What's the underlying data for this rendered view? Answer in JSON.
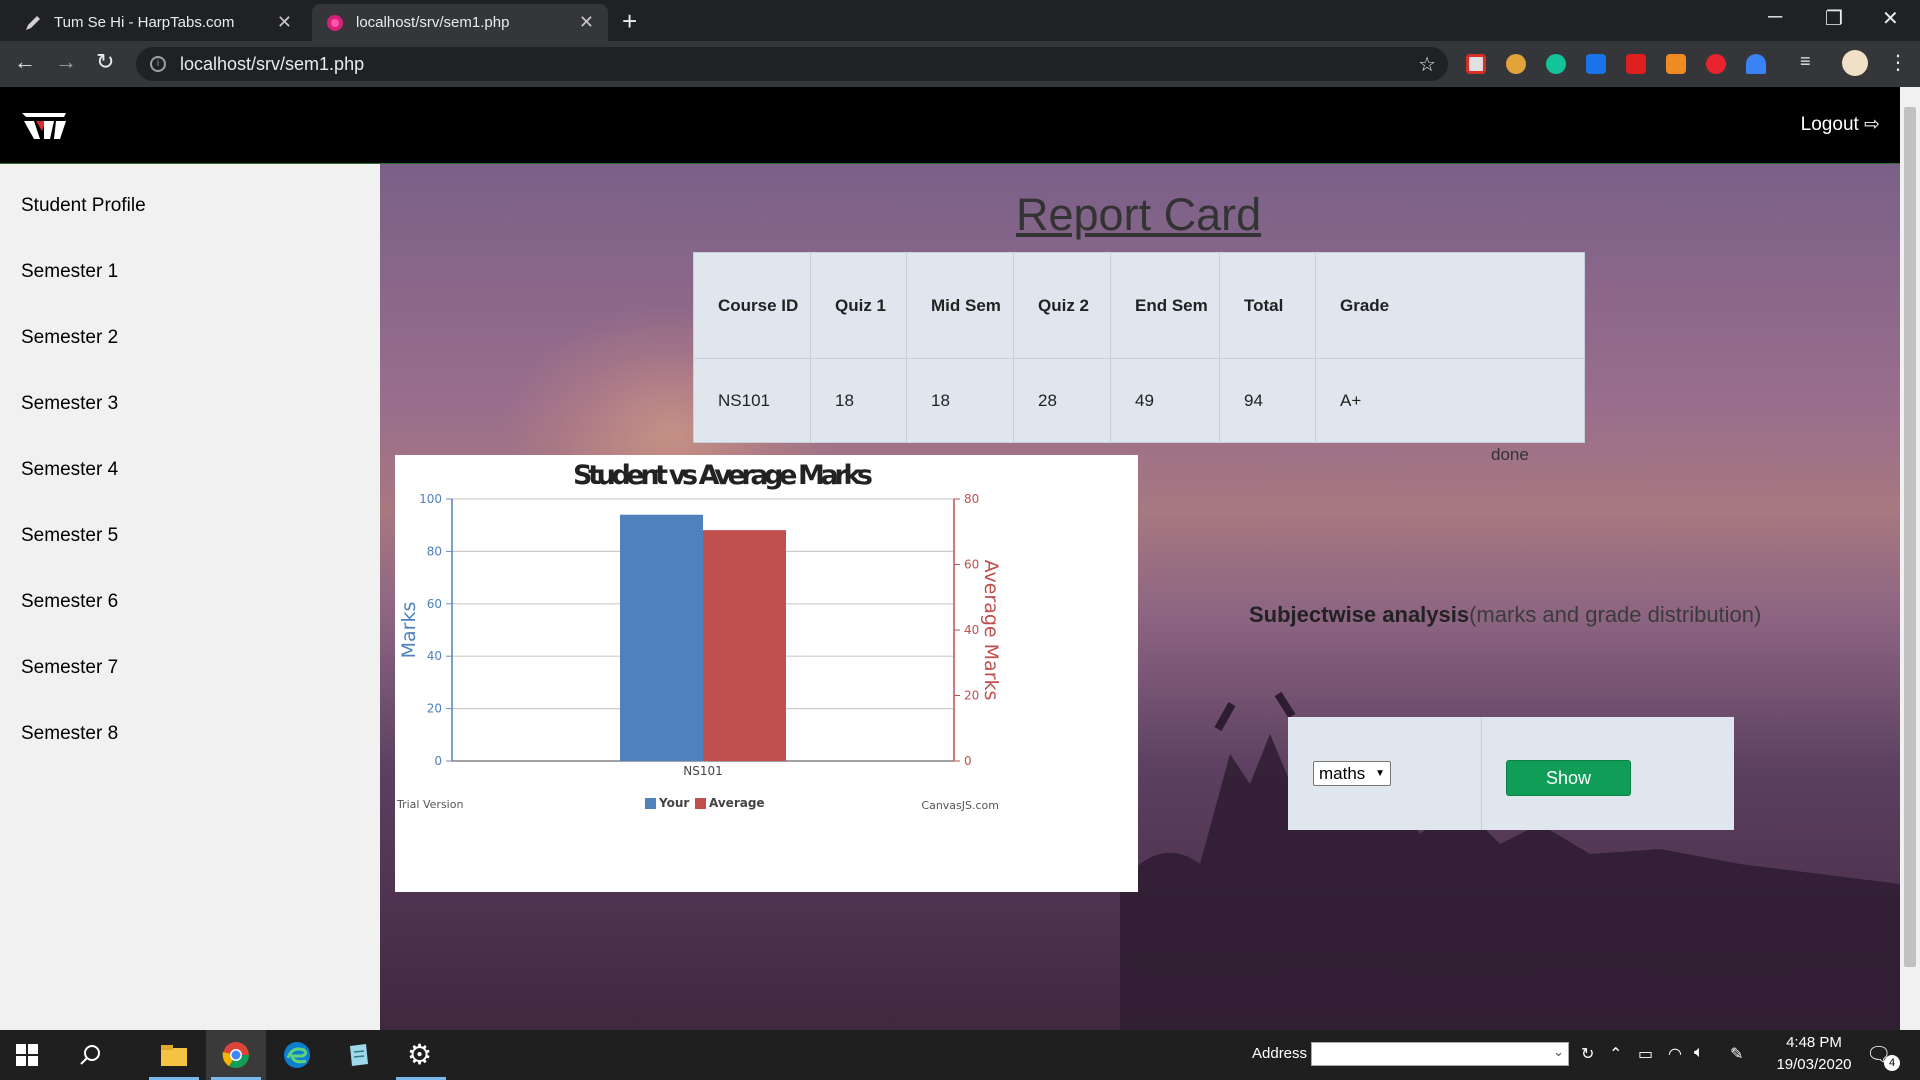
{
  "browser": {
    "tabs": [
      {
        "title": "Tum Se Hi - HarpTabs.com",
        "active": false
      },
      {
        "title": "localhost/srv/sem1.php",
        "active": true
      }
    ],
    "url": "localhost/srv/sem1.php"
  },
  "header": {
    "logout_label": "Logout"
  },
  "sidebar": {
    "items": [
      {
        "label": "Student Profile"
      },
      {
        "label": "Semester 1"
      },
      {
        "label": "Semester 2"
      },
      {
        "label": "Semester 3"
      },
      {
        "label": "Semester 4"
      },
      {
        "label": "Semester 5"
      },
      {
        "label": "Semester 6"
      },
      {
        "label": "Semester 7"
      },
      {
        "label": "Semester 8"
      }
    ]
  },
  "main": {
    "title": "Report Card",
    "table": {
      "headers": [
        "Course ID",
        "Quiz 1",
        "Mid Sem",
        "Quiz 2",
        "End Sem",
        "Total",
        "Grade"
      ],
      "rows": [
        [
          "NS101",
          "18",
          "18",
          "28",
          "49",
          "94",
          "A+"
        ]
      ]
    },
    "status_text": "done",
    "analysis": {
      "bold": "Subjectwise analysis",
      "rest": "(marks and grade distribution)",
      "selected_subject": "maths",
      "show_label": "Show"
    }
  },
  "chart_data": {
    "type": "bar",
    "title": "Student vs Average Marks",
    "categories": [
      "NS101"
    ],
    "series": [
      {
        "name": "Your",
        "values": [
          94
        ],
        "axis": "primary",
        "color": "#4f81bc"
      },
      {
        "name": "Average",
        "values": [
          70.5
        ],
        "axis": "secondary",
        "color": "#c0504e"
      }
    ],
    "ylabel": "Marks",
    "y2label": "Average Marks",
    "ylim": [
      0,
      100
    ],
    "y2lim": [
      0,
      80
    ],
    "yticks": [
      0,
      20,
      40,
      60,
      80,
      100
    ],
    "y2ticks": [
      0,
      20,
      40,
      60,
      80
    ],
    "legend": "bottom-center",
    "grid": true,
    "footer_left": "Trial Version",
    "footer_right": "CanvasJS.com"
  },
  "taskbar": {
    "address_label": "Address",
    "time": "4:48 PM",
    "date": "19/03/2020",
    "notification_count": "4"
  }
}
